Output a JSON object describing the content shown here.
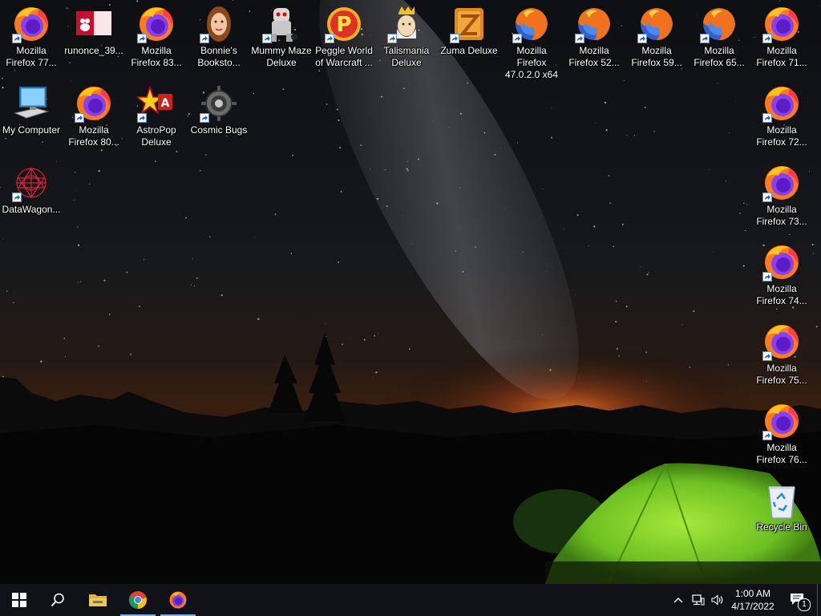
{
  "desktop": {
    "icons": [
      {
        "label": "Mozilla Firefox 77...",
        "icon": "firefox-icon",
        "shortcut": true
      },
      {
        "label": "runonce_39...",
        "icon": "runonce-icon",
        "shortcut": false
      },
      {
        "label": "Mozilla Firefox 83...",
        "icon": "firefox-icon",
        "shortcut": true
      },
      {
        "label": "Bonnie's Booksto...",
        "icon": "bonnies-bookstore-icon",
        "shortcut": true
      },
      {
        "label": "Mummy Maze Deluxe",
        "icon": "mummy-maze-icon",
        "shortcut": true
      },
      {
        "label": "Peggle World of Warcraft ...",
        "icon": "peggle-icon",
        "shortcut": true
      },
      {
        "label": "Talismania Deluxe",
        "icon": "talismania-icon",
        "shortcut": true
      },
      {
        "label": "Zuma Deluxe",
        "icon": "zuma-icon",
        "shortcut": true
      },
      {
        "label": "Mozilla Firefox 47.0.2.0 x64",
        "icon": "firefox-old-icon",
        "shortcut": true
      },
      {
        "label": "Mozilla Firefox 52...",
        "icon": "firefox-old-icon",
        "shortcut": true
      },
      {
        "label": "Mozilla Firefox 59...",
        "icon": "firefox-old-icon",
        "shortcut": true
      },
      {
        "label": "Mozilla Firefox 65...",
        "icon": "firefox-old-icon",
        "shortcut": true
      },
      {
        "label": "Mozilla Firefox 71...",
        "icon": "firefox-icon",
        "shortcut": true
      },
      {
        "label": "My Computer",
        "icon": "computer-icon",
        "shortcut": false
      },
      {
        "label": "Mozilla Firefox 80...",
        "icon": "firefox-icon",
        "shortcut": true
      },
      {
        "label": "AstroPop Deluxe",
        "icon": "astropop-icon",
        "shortcut": true
      },
      {
        "label": "Cosmic Bugs",
        "icon": "cosmic-bugs-icon",
        "shortcut": true
      },
      {
        "label": "Mozilla Firefox 72...",
        "icon": "firefox-icon",
        "shortcut": true
      },
      {
        "label": "DataWagon...",
        "icon": "datawagon-icon",
        "shortcut": true
      },
      {
        "label": "Mozilla Firefox 73...",
        "icon": "firefox-icon",
        "shortcut": true
      },
      {
        "label": "Mozilla Firefox 74...",
        "icon": "firefox-icon",
        "shortcut": true
      },
      {
        "label": "Mozilla Firefox 75...",
        "icon": "firefox-icon",
        "shortcut": true
      },
      {
        "label": "Mozilla Firefox 76...",
        "icon": "firefox-icon",
        "shortcut": true
      },
      {
        "label": "Recycle Bin",
        "icon": "recycle-bin-icon",
        "shortcut": false
      }
    ]
  },
  "taskbar": {
    "start": {
      "icon": "windows-start-icon"
    },
    "search": {
      "icon": "search-icon"
    },
    "pinned": [
      {
        "icon": "file-explorer-icon",
        "active": false
      },
      {
        "icon": "chrome-icon",
        "active": true
      },
      {
        "icon": "firefox-icon",
        "active": true
      }
    ],
    "tray": {
      "time": "1:00 AM",
      "date": "4/17/2022",
      "notification_count": "1"
    }
  },
  "colors": {
    "taskbar_bg": "#101218",
    "label_text": "#ffffff",
    "sky_glow": "#e06a1a",
    "tent_green": "#7fd02a"
  }
}
